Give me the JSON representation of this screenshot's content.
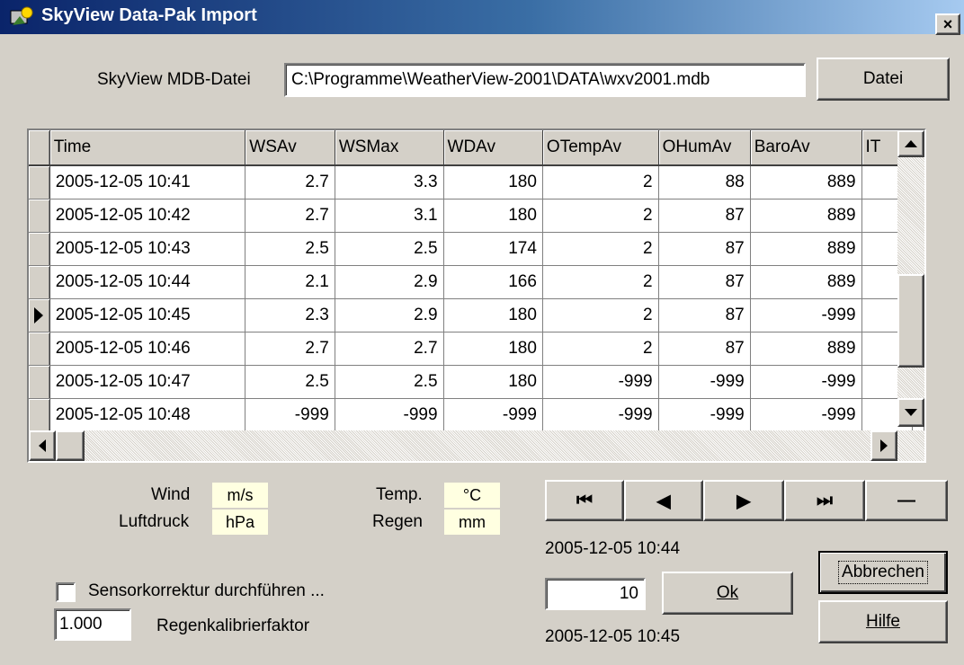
{
  "window": {
    "title": "SkyView Data-Pak Import",
    "close_label": "×"
  },
  "file": {
    "label": "SkyView MDB-Datei",
    "path": "C:\\Programme\\WeatherView-2001\\DATA\\wxv2001.mdb",
    "button_label": "Datei"
  },
  "grid": {
    "columns": [
      "Time",
      "WSAv",
      "WSMax",
      "WDAv",
      "OTempAv",
      "OHumAv",
      "BaroAv",
      "IT"
    ],
    "current_row_index": 4,
    "rows": [
      [
        "2005-12-05 10:41",
        "2.7",
        "3.3",
        "180",
        "2",
        "88",
        "889"
      ],
      [
        "2005-12-05 10:42",
        "2.7",
        "3.1",
        "180",
        "2",
        "87",
        "889"
      ],
      [
        "2005-12-05 10:43",
        "2.5",
        "2.5",
        "174",
        "2",
        "87",
        "889"
      ],
      [
        "2005-12-05 10:44",
        "2.1",
        "2.9",
        "166",
        "2",
        "87",
        "889"
      ],
      [
        "2005-12-05 10:45",
        "2.3",
        "2.9",
        "180",
        "2",
        "87",
        "-999"
      ],
      [
        "2005-12-05 10:46",
        "2.7",
        "2.7",
        "180",
        "2",
        "87",
        "889"
      ],
      [
        "2005-12-05 10:47",
        "2.5",
        "2.5",
        "180",
        "-999",
        "-999",
        "-999"
      ],
      [
        "2005-12-05 10:48",
        "-999",
        "-999",
        "-999",
        "-999",
        "-999",
        "-999"
      ]
    ]
  },
  "units": {
    "wind_label": "Wind",
    "wind_unit": "m/s",
    "baro_label": "Luftdruck",
    "baro_unit": "hPa",
    "temp_label": "Temp.",
    "temp_unit": "°C",
    "rain_label": "Regen",
    "rain_unit": "mm"
  },
  "navigator": {
    "first": "⏮",
    "prior": "◀",
    "next": "▶",
    "last": "⏭",
    "delete": "—"
  },
  "status": {
    "start_time": "2005-12-05 10:44",
    "end_time": "2005-12-05 10:45",
    "count_value": "10"
  },
  "buttons": {
    "ok": "Ok",
    "cancel": "Abbrechen",
    "help": "Hilfe"
  },
  "sensor": {
    "checkbox_label": "Sensorkorrektur durchführen ...",
    "checked": false,
    "factor_value": "1.000",
    "factor_label": "Regenkalibrierfaktor"
  },
  "colors": {
    "titlebar_start": "#0a246a",
    "titlebar_end": "#a6caf0",
    "face": "#d4d0c8",
    "unit_bg": "#ffffe1"
  },
  "icons": {
    "app": "skyview-app-icon",
    "close": "close-icon",
    "row_pointer": "row-pointer-icon"
  }
}
